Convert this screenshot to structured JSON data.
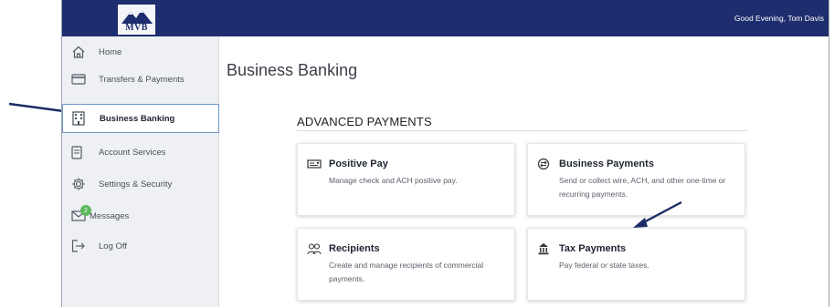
{
  "app": {
    "logo_text": "MVB",
    "greeting": "Good Evening, Tom Davis"
  },
  "sidebar": {
    "items": [
      {
        "label": "Home",
        "icon": "home-icon"
      },
      {
        "label": "Transfers & Payments",
        "icon": "card-icon"
      },
      {
        "label": "Business Banking",
        "icon": "bank-building-icon",
        "active": true
      },
      {
        "label": "Account Services",
        "icon": "document-icon"
      },
      {
        "label": "Settings & Security",
        "icon": "gear-icon"
      },
      {
        "label": "Messages",
        "icon": "envelope-icon",
        "badge": "2"
      },
      {
        "label": "Log Off",
        "icon": "logout-icon"
      }
    ]
  },
  "main": {
    "title": "Business Banking",
    "section_title": "ADVANCED PAYMENTS",
    "cards": [
      {
        "title": "Positive Pay",
        "description": "Manage check and ACH positive pay.",
        "icon": "check-icon"
      },
      {
        "title": "Business Payments",
        "description": "Send or collect wire, ACH, and other one-time or recurring payments.",
        "icon": "money-transfer-icon"
      },
      {
        "title": "Recipients",
        "description": "Create and manage recipients of commercial payments.",
        "icon": "people-icon"
      },
      {
        "title": "Tax Payments",
        "description": "Pay federal or state taxes.",
        "icon": "government-building-icon"
      }
    ]
  },
  "colors": {
    "header": "#1e2d6e",
    "sidebar_bg": "#eef0f3",
    "active_border": "#6e98c7",
    "badge": "#5cb85c",
    "annotation_arrow": "#1b2b63"
  }
}
